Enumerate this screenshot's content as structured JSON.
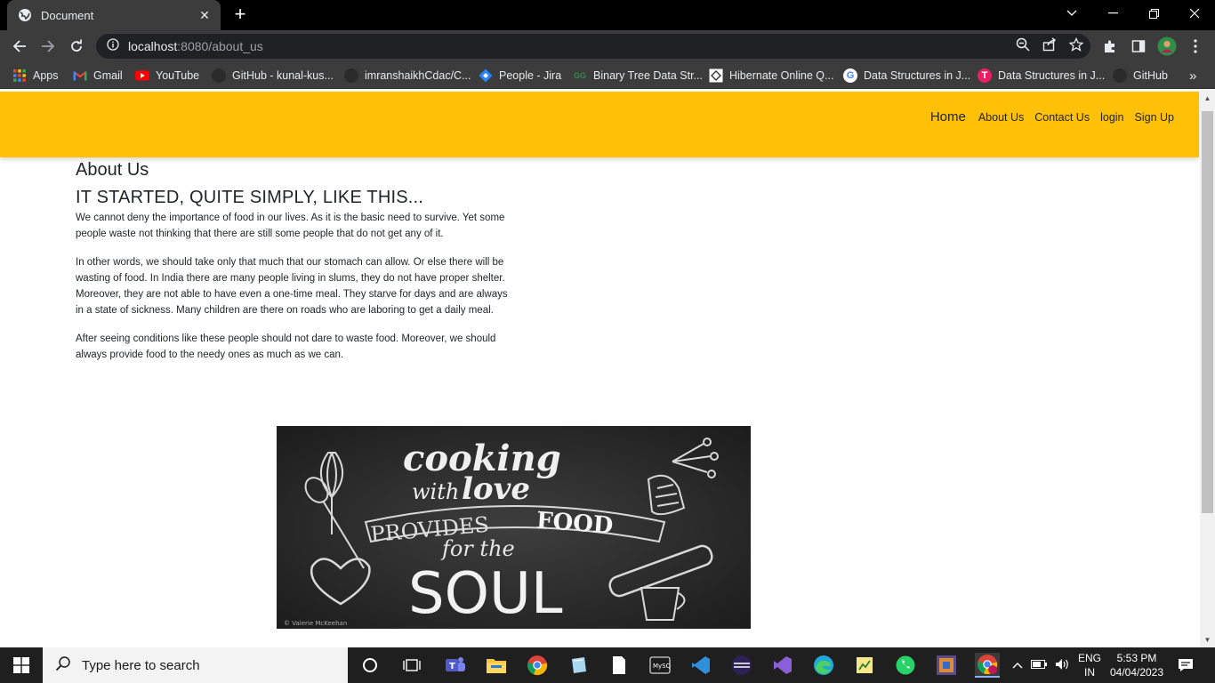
{
  "browser": {
    "tab_title": "Document",
    "new_tab_label": "+",
    "url_host": "localhost",
    "url_rest": ":8080/about_us",
    "bookmarks": [
      {
        "label": "Apps",
        "icon": "apps-grid-icon"
      },
      {
        "label": "Gmail",
        "icon": "gmail-icon"
      },
      {
        "label": "YouTube",
        "icon": "youtube-icon"
      },
      {
        "label": "GitHub - kunal-kus...",
        "icon": "github-icon"
      },
      {
        "label": "imranshaikhCdac/C...",
        "icon": "github-icon"
      },
      {
        "label": "People - Jira",
        "icon": "jira-icon"
      },
      {
        "label": "Binary Tree Data Str...",
        "icon": "geeksforgeeks-icon"
      },
      {
        "label": "Hibernate Online Q...",
        "icon": "hibernate-icon"
      },
      {
        "label": "Data Structures in J...",
        "icon": "google-icon"
      },
      {
        "label": "Data Structures in J...",
        "icon": "t-logo-icon"
      },
      {
        "label": "GitHub",
        "icon": "github-icon"
      }
    ],
    "more_bookmarks_label": "»"
  },
  "site": {
    "nav": {
      "home": "Home",
      "about": "About Us",
      "contact": "Contact Us",
      "login": "login",
      "signup": "Sign Up"
    },
    "page_title": "About Us",
    "subtitle": "IT STARTED, QUITE SIMPLY, LIKE THIS...",
    "paragraphs": [
      "We cannot deny the importance of food in our lives. As it is the basic need to survive. Yet some people waste not thinking that there are still some people that do not get any of it.",
      "In other words, we should take only that much that our stomach can allow. Or else there will be wasting of food. In India there are many people living in slums, they do not have proper shelter. Moreover, they are not able to have even a one-time meal. They starve for days and are always in a state of sickness. Many children are there on roads who are laboring to get a daily meal.",
      "After seeing conditions like these people should not dare to waste food. Moreover, we should always provide food to the needy ones as much as we can."
    ],
    "hero_image": {
      "line1": "cooking",
      "line2a": "with",
      "line2b": "love",
      "line3a": "PROVIDES",
      "line3b": "FOOD",
      "line4": "for the",
      "line5": "SOUL",
      "credit": "© Valerie McKeehan"
    },
    "colors": {
      "header": "#ffc107",
      "text": "#212529"
    }
  },
  "taskbar": {
    "search_placeholder": "Type here to search",
    "language": "ENG",
    "region": "IN",
    "time": "5:53 PM",
    "date": "04/04/2023"
  }
}
